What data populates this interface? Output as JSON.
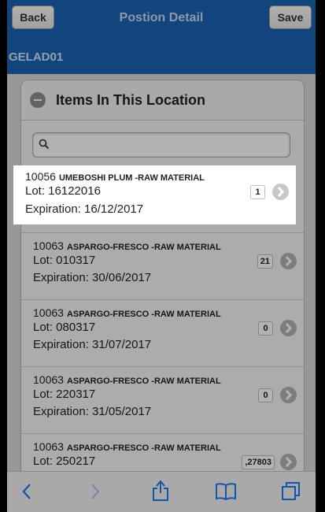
{
  "header": {
    "back_label": "Back",
    "title": "Postion Detail",
    "save_label": "Save",
    "location_code": "GELAD01"
  },
  "panel": {
    "title": "Items In This Location",
    "search_placeholder": ""
  },
  "items": [
    {
      "code": "10056",
      "desc": "UMEBOSHI PLUM -RAW MATERIAL",
      "lot": "Lot: 16122016",
      "exp": "Expiration: 16/12/2017",
      "qty": "1"
    },
    {
      "code": "10063",
      "desc": "ASPARGO-FRESCO -RAW MATERIAL",
      "lot": "Lot: 010317",
      "exp": "Expiration: 30/06/2017",
      "qty": "21"
    },
    {
      "code": "10063",
      "desc": "ASPARGO-FRESCO -RAW MATERIAL",
      "lot": "Lot: 080317",
      "exp": "Expiration: 31/07/2017",
      "qty": "0"
    },
    {
      "code": "10063",
      "desc": "ASPARGO-FRESCO -RAW MATERIAL",
      "lot": "Lot: 220317",
      "exp": "Expiration: 31/05/2017",
      "qty": "0"
    },
    {
      "code": "10063",
      "desc": "ASPARGO-FRESCO -RAW MATERIAL",
      "lot": "Lot: 250217",
      "exp": "",
      "qty": ",27803"
    }
  ],
  "toolbar": {
    "icons": [
      "back-arrow-icon",
      "forward-arrow-icon",
      "share-icon",
      "bookmarks-icon",
      "tabs-icon"
    ]
  },
  "colors": {
    "header_bg": "#1b63b3",
    "highlight_bg": "#ffffff"
  }
}
